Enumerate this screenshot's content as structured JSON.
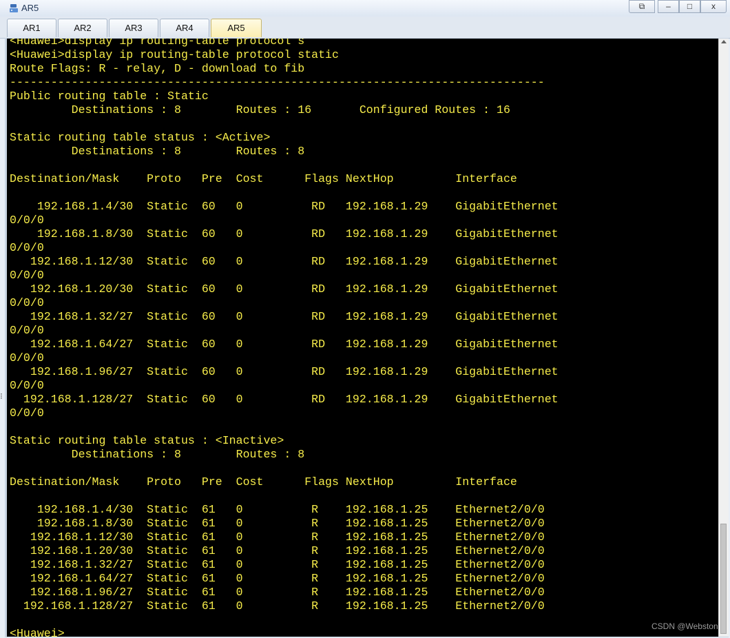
{
  "window": {
    "title": "AR5",
    "restore_glyph": "⧉",
    "minimize_glyph": "–",
    "maximize_glyph": "□",
    "close_glyph": "x"
  },
  "tabs": [
    {
      "label": "AR1"
    },
    {
      "label": "AR2"
    },
    {
      "label": "AR3"
    },
    {
      "label": "AR4"
    },
    {
      "label": "AR5"
    }
  ],
  "active_tab": "AR5",
  "terminal": {
    "text_color": "#f6ec4a",
    "background": "#000000",
    "lines": [
      "<Huawei>display ip routing-table protocol s",
      "<Huawei>display ip routing-table protocol static",
      "Route Flags: R - relay, D - download to fib",
      "------------------------------------------------------------------------------",
      "Public routing table : Static",
      "         Destinations : 8        Routes : 16       Configured Routes : 16",
      "",
      "Static routing table status : <Active>",
      "         Destinations : 8        Routes : 8",
      "",
      "Destination/Mask    Proto   Pre  Cost      Flags NextHop         Interface",
      "",
      "    192.168.1.4/30  Static  60   0          RD   192.168.1.29    GigabitEthernet",
      "0/0/0",
      "    192.168.1.8/30  Static  60   0          RD   192.168.1.29    GigabitEthernet",
      "0/0/0",
      "   192.168.1.12/30  Static  60   0          RD   192.168.1.29    GigabitEthernet",
      "0/0/0",
      "   192.168.1.20/30  Static  60   0          RD   192.168.1.29    GigabitEthernet",
      "0/0/0",
      "   192.168.1.32/27  Static  60   0          RD   192.168.1.29    GigabitEthernet",
      "0/0/0",
      "   192.168.1.64/27  Static  60   0          RD   192.168.1.29    GigabitEthernet",
      "0/0/0",
      "   192.168.1.96/27  Static  60   0          RD   192.168.1.29    GigabitEthernet",
      "0/0/0",
      "  192.168.1.128/27  Static  60   0          RD   192.168.1.29    GigabitEthernet",
      "0/0/0",
      "",
      "Static routing table status : <Inactive>",
      "         Destinations : 8        Routes : 8",
      "",
      "Destination/Mask    Proto   Pre  Cost      Flags NextHop         Interface",
      "",
      "    192.168.1.4/30  Static  61   0          R    192.168.1.25    Ethernet2/0/0",
      "    192.168.1.8/30  Static  61   0          R    192.168.1.25    Ethernet2/0/0",
      "   192.168.1.12/30  Static  61   0          R    192.168.1.25    Ethernet2/0/0",
      "   192.168.1.20/30  Static  61   0          R    192.168.1.25    Ethernet2/0/0",
      "   192.168.1.32/27  Static  61   0          R    192.168.1.25    Ethernet2/0/0",
      "   192.168.1.64/27  Static  61   0          R    192.168.1.25    Ethernet2/0/0",
      "   192.168.1.96/27  Static  61   0          R    192.168.1.25    Ethernet2/0/0",
      "  192.168.1.128/27  Static  61   0          R    192.168.1.25    Ethernet2/0/0",
      "",
      "<Huawei>"
    ]
  },
  "watermark": "CSDN @Webston",
  "edge_mark": "⁝"
}
